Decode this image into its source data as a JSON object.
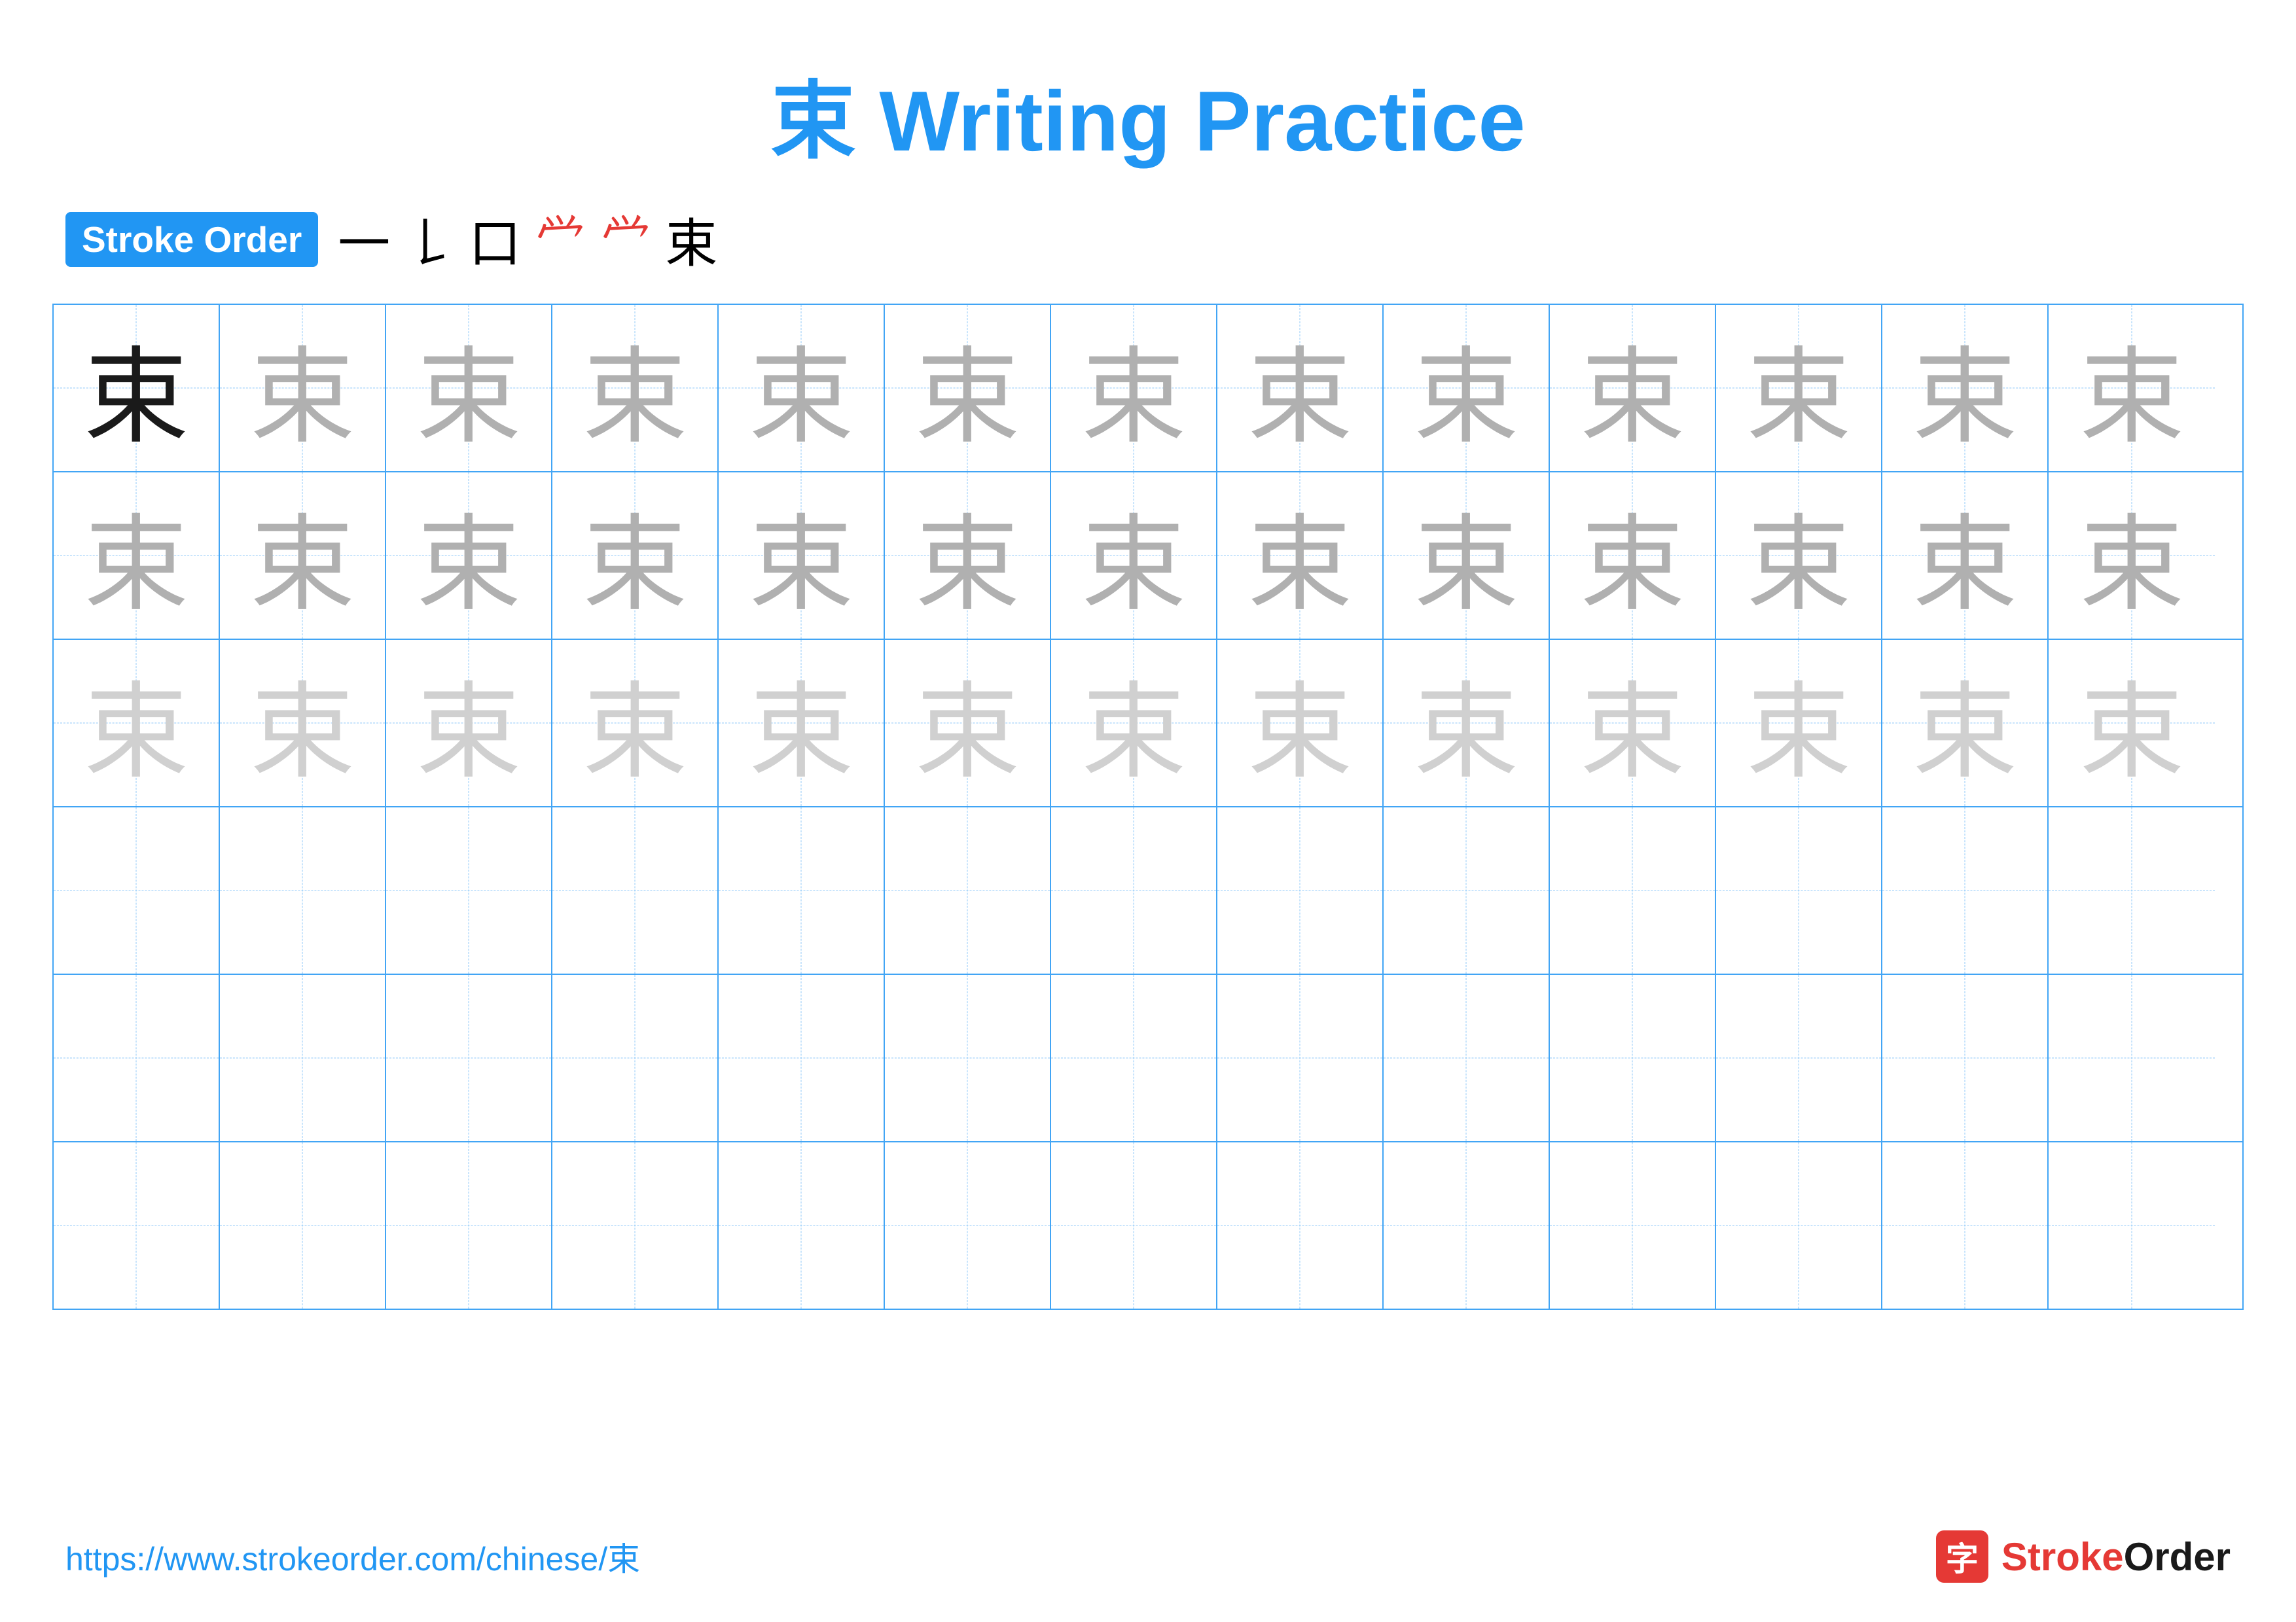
{
  "title": {
    "char": "束",
    "text": " Writing Practice"
  },
  "stroke_order": {
    "badge_label": "Stroke Order",
    "steps": [
      "一",
      "𠄌",
      "口",
      "𠭜",
      "𠭜",
      "束"
    ]
  },
  "grid": {
    "cols": 13,
    "rows": 6,
    "char": "束",
    "row_configs": [
      {
        "type": "dark_then_medium",
        "dark_count": 1,
        "medium_count": 12
      },
      {
        "type": "medium",
        "count": 13
      },
      {
        "type": "light",
        "count": 13
      },
      {
        "type": "empty"
      },
      {
        "type": "empty"
      },
      {
        "type": "empty"
      }
    ]
  },
  "footer": {
    "url": "https://www.strokeorder.com/chinese/束",
    "logo_char": "字",
    "logo_name": "StrokeOrder"
  }
}
